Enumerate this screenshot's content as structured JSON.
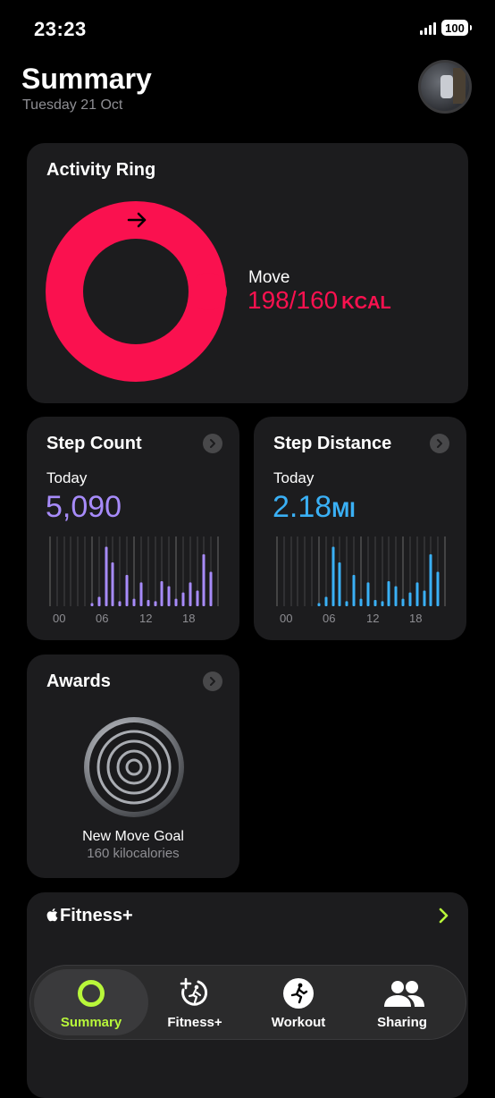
{
  "status": {
    "time": "23:23",
    "battery": "100"
  },
  "header": {
    "title": "Summary",
    "date": "Tuesday 21 Oct"
  },
  "activity": {
    "title": "Activity Ring",
    "label": "Move",
    "value": "198/160",
    "unit": "KCAL",
    "goal": 160,
    "current": 198,
    "color": "#fa114f"
  },
  "steps": {
    "title": "Step Count",
    "today": "Today",
    "value": "5,090",
    "color": "#a78bfa",
    "hours": [
      "00",
      "06",
      "12",
      "18"
    ],
    "bars": [
      0,
      0,
      0,
      0,
      0,
      0,
      0.05,
      0.15,
      0.95,
      0.7,
      0.08,
      0.5,
      0.12,
      0.38,
      0.1,
      0.08,
      0.4,
      0.32,
      0.12,
      0.22,
      0.38,
      0.25,
      0.83,
      0.55,
      0
    ]
  },
  "distance": {
    "title": "Step Distance",
    "today": "Today",
    "value": "2.18",
    "unit": "MI",
    "color": "#3ab0f5",
    "hours": [
      "00",
      "06",
      "12",
      "18"
    ],
    "bars": [
      0,
      0,
      0,
      0,
      0,
      0,
      0.05,
      0.15,
      0.95,
      0.7,
      0.08,
      0.5,
      0.12,
      0.38,
      0.1,
      0.08,
      0.4,
      0.32,
      0.12,
      0.22,
      0.38,
      0.25,
      0.83,
      0.55,
      0
    ]
  },
  "awards": {
    "title": "Awards",
    "name": "New Move Goal",
    "desc": "160 kilocalories"
  },
  "fitness": {
    "title": "Fitness+"
  },
  "tabs": [
    {
      "label": "Summary",
      "icon": "activity-ring-icon",
      "active": true
    },
    {
      "label": "Fitness+",
      "icon": "fitness-plus-icon",
      "active": false
    },
    {
      "label": "Workout",
      "icon": "workout-runner-icon",
      "active": false
    },
    {
      "label": "Sharing",
      "icon": "sharing-people-icon",
      "active": false
    }
  ],
  "colors": {
    "accent_green": "#b8f73a",
    "move_red": "#fa114f"
  }
}
